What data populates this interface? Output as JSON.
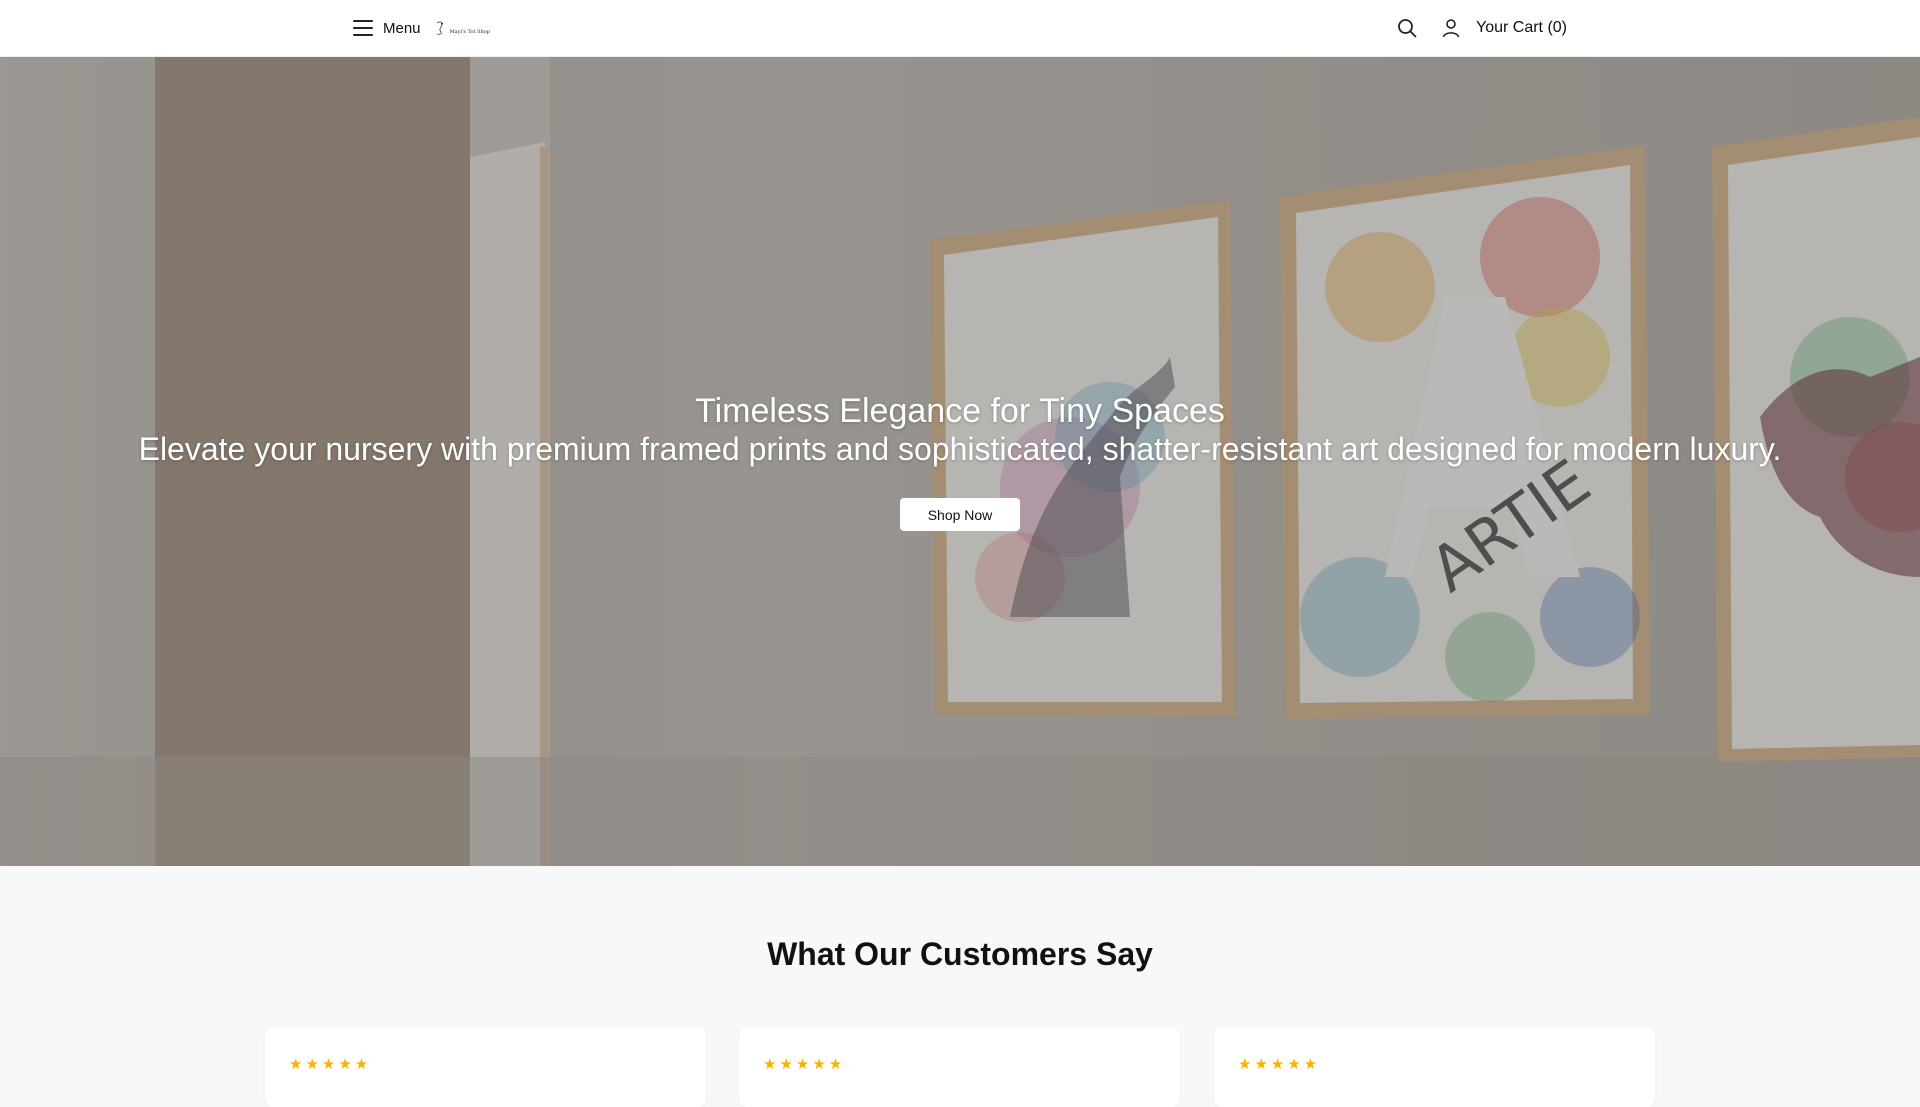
{
  "header": {
    "menu_label": "Menu",
    "cart_label": "Your Cart (0)",
    "icons": {
      "menu": "hamburger-icon",
      "search": "search-icon",
      "account": "user-icon"
    },
    "logo_text": "Mayi's Tot Shop"
  },
  "hero": {
    "title": "Timeless Elegance for Tiny Spaces",
    "subtitle": "Elevate your nursery with premium framed prints and sophisticated, shatter-resistant art designed for modern luxury.",
    "cta_label": "Shop Now",
    "art_letter": "A",
    "art_name": "ARTIE"
  },
  "testimonials": {
    "title": "What Our Customers Say",
    "cards": [
      {
        "stars": "★★★★★",
        "rating": 5
      },
      {
        "stars": "★★★★★",
        "rating": 5
      },
      {
        "stars": "★★★★★",
        "rating": 5
      }
    ]
  },
  "colors": {
    "star": "#f4b400",
    "header_bg": "#ffffff",
    "section_bg": "#f7f8fa"
  }
}
